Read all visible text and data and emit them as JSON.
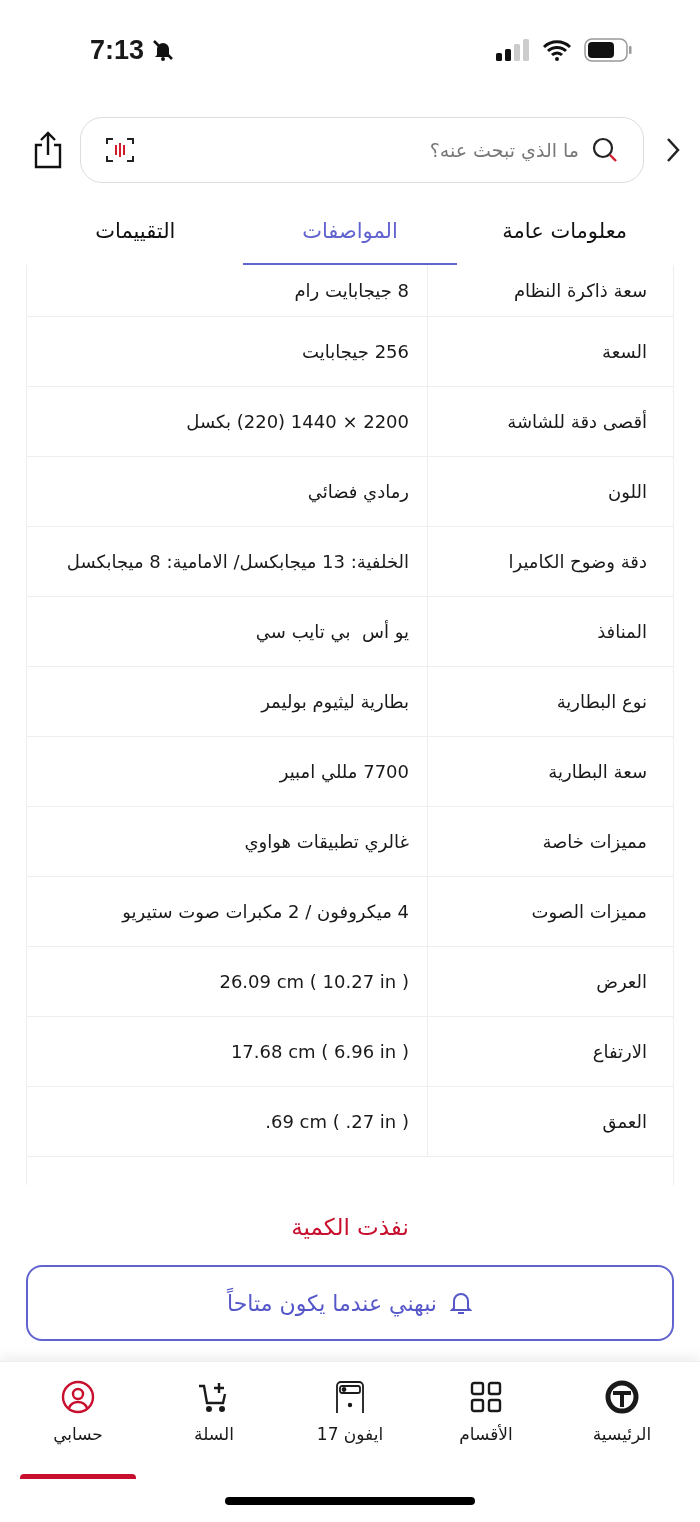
{
  "status_bar": {
    "time": "7:13"
  },
  "search": {
    "placeholder": "ما الذي تبحث عنه؟"
  },
  "tabs": [
    {
      "label": "معلومات عامة",
      "selected": false
    },
    {
      "label": "المواصفات",
      "selected": true
    },
    {
      "label": "التقييمات",
      "selected": false
    }
  ],
  "specs": [
    {
      "name": "سعة ذاكرة النظام",
      "value": "8 جيجابايت رام"
    },
    {
      "name": "السعة",
      "value": "256 جيجابايت"
    },
    {
      "name": "أقصى دقة للشاشة",
      "value": "2200 × 1440 (220) بكسل"
    },
    {
      "name": "اللون",
      "value": "رمادي فضائي"
    },
    {
      "name": "دقة وضوح الكاميرا",
      "value": "الخلفية: 13 ميجابكسل/ الامامية: 8 ميجابكسل"
    },
    {
      "name": "المنافذ",
      "value": "يو أس  بي تايب سي"
    },
    {
      "name": "نوع البطارية",
      "value": "بطارية ليثيوم بوليمر"
    },
    {
      "name": "سعة البطارية",
      "value": "7700 مللي امبير"
    },
    {
      "name": "مميزات خاصة",
      "value": "غالري تطبيقات هواوي"
    },
    {
      "name": "مميزات الصوت",
      "value": "4 ميكروفون / 2 مكبرات صوت ستيريو"
    },
    {
      "name": "العرض",
      "value": "26.09 cm ( 10.27 in )"
    },
    {
      "name": "الارتفاع",
      "value": "17.68 cm ( 6.96 in )"
    },
    {
      "name": "العمق",
      "value": ".69 cm ( .27 in )"
    }
  ],
  "stock_status": "نفذت الكمية",
  "notify_button": "نبهني عندما يكون متاحاً",
  "nav": [
    {
      "kind": "home",
      "label": "الرئيسية",
      "selected": false
    },
    {
      "kind": "categories",
      "label": "الأقسام",
      "selected": false
    },
    {
      "kind": "phone",
      "label": "ايفون 17",
      "selected": false
    },
    {
      "kind": "cart",
      "label": "السلة",
      "selected": false
    },
    {
      "kind": "account",
      "label": "حسابي",
      "selected": true
    }
  ]
}
